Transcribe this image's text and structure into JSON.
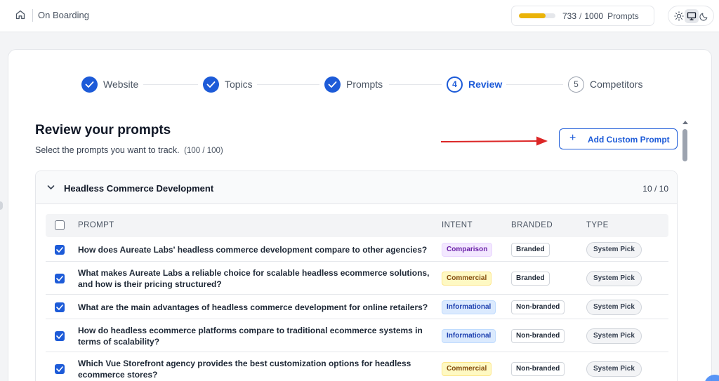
{
  "header": {
    "breadcrumb": "On Boarding",
    "quota": {
      "used": "733",
      "sep": "/",
      "total": "1000",
      "unit": "Prompts",
      "progress": 0.733
    },
    "theme_options": [
      "sun-icon",
      "monitor-icon",
      "moon-icon"
    ],
    "theme_selected": "monitor-icon"
  },
  "stepper": {
    "steps": [
      {
        "label": "Website",
        "state": "done",
        "number": "1"
      },
      {
        "label": "Topics",
        "state": "done",
        "number": "2"
      },
      {
        "label": "Prompts",
        "state": "done",
        "number": "3"
      },
      {
        "label": "Review",
        "state": "current",
        "number": "4"
      },
      {
        "label": "Competitors",
        "state": "todo",
        "number": "5"
      }
    ]
  },
  "review": {
    "title": "Review your prompts",
    "subtitle": "Select the prompts you want to track.",
    "selected_count": "(100 / 100)",
    "add_button": "Add Custom Prompt"
  },
  "section": {
    "name": "Headless Commerce Development",
    "count": "10 / 10",
    "columns": [
      "PROMPT",
      "INTENT",
      "BRANDED",
      "TYPE"
    ],
    "rows": [
      {
        "checked": true,
        "prompt": "How does Aureate Labs' headless commerce development compare to other agencies?",
        "intent": "Comparison",
        "branded": "Branded",
        "type": "System Pick"
      },
      {
        "checked": true,
        "prompt": "What makes Aureate Labs a reliable choice for scalable headless ecommerce solutions, and how is their pricing structured?",
        "intent": "Commercial",
        "branded": "Branded",
        "type": "System Pick"
      },
      {
        "checked": true,
        "prompt": "What are the main advantages of headless commerce development for online retailers?",
        "intent": "Informational",
        "branded": "Non-branded",
        "type": "System Pick"
      },
      {
        "checked": true,
        "prompt": "How do headless ecommerce platforms compare to traditional ecommerce systems in terms of scalability?",
        "intent": "Informational",
        "branded": "Non-branded",
        "type": "System Pick"
      },
      {
        "checked": true,
        "prompt": "Which Vue Storefront agency provides the best customization options for headless ecommerce stores?",
        "intent": "Commercial",
        "branded": "Non-branded",
        "type": "System Pick"
      }
    ]
  },
  "colors": {
    "accent": "#1d5bd8",
    "arrow": "#dc2626",
    "quota_fill": "#eab308"
  }
}
